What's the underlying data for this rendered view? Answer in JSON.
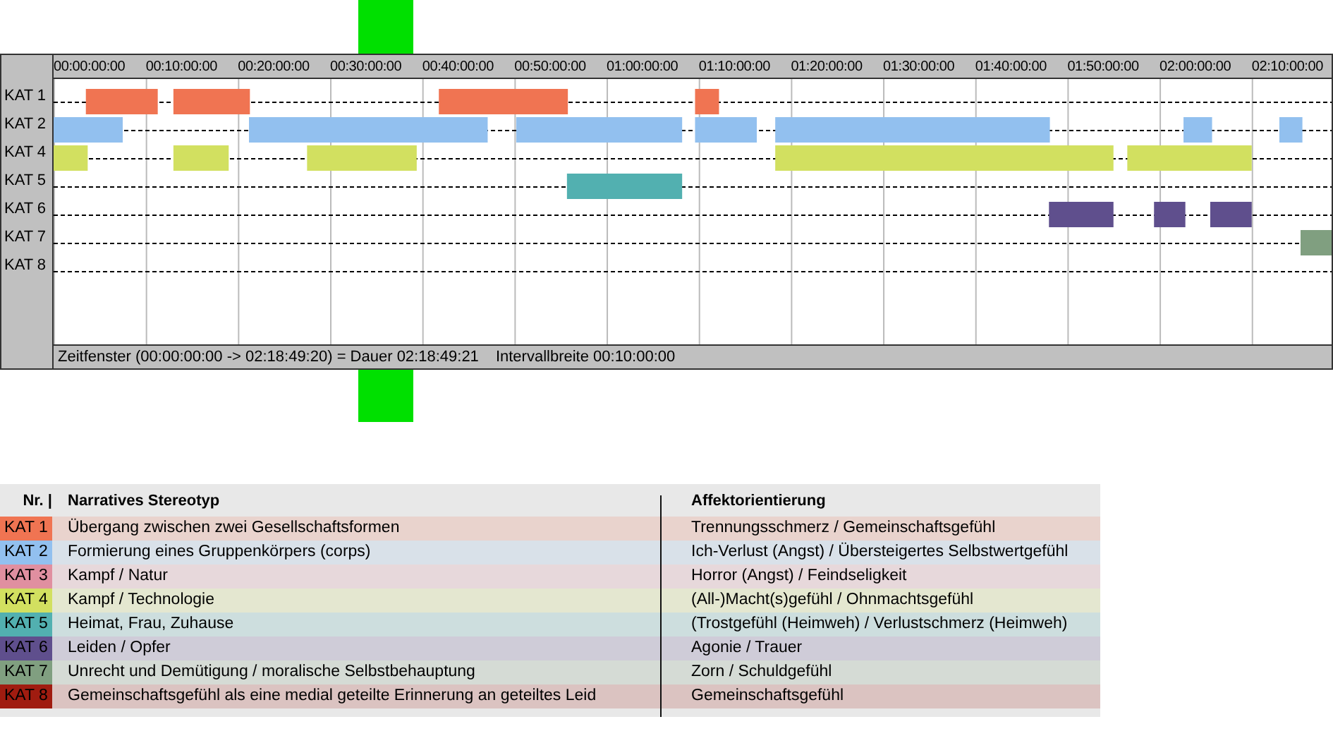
{
  "timeline": {
    "ruler_ticks": [
      "00:00:00:00",
      "00:10:00:00",
      "00:20:00:00",
      "00:30:00:00",
      "00:40:00:00",
      "00:50:00:00",
      "01:00:00:00",
      "01:10:00:00",
      "01:20:00:00",
      "01:30:00:00",
      "01:40:00:00",
      "01:50:00:00",
      "02:00:00:00",
      "02:10:00:00"
    ],
    "rows": [
      {
        "label": "KAT 1",
        "color": "#f07452"
      },
      {
        "label": "KAT 2",
        "color": "#92c0ef"
      },
      {
        "label": "KAT 4",
        "color": "#d2e060"
      },
      {
        "label": "KAT 5",
        "color": "#52b0b0"
      },
      {
        "label": "KAT 6",
        "color": "#5f4f8d"
      },
      {
        "label": "KAT 7",
        "color": "#809f80"
      },
      {
        "label": "KAT 8"
      }
    ],
    "status": {
      "window": "Zeitfenster (00:00:00:00 -> 02:18:49:20) = Dauer 02:18:49:21",
      "interval": "Intervallbreite 00:10:00:00"
    }
  },
  "legend": {
    "headers": [
      "Nr. |",
      "Narratives Stereotyp",
      "Affektorientierung"
    ],
    "rows": [
      {
        "nr": "KAT 1",
        "color": "#f07452",
        "stereotype": "Übergang zwischen zwei Gesellschaftsformen",
        "affect": "Trennungsschmerz / Gemeinschaftsgefühl"
      },
      {
        "nr": "KAT 2",
        "color": "#92c0ef",
        "stereotype": "Formierung eines Gruppenkörpers (corps)",
        "affect": "Ich-Verlust (Angst) / Übersteigertes Selbstwertgefühl"
      },
      {
        "nr": "KAT 3",
        "color": "#e08fa0",
        "stereotype": "Kampf / Natur",
        "affect": "Horror (Angst) / Feindseligkeit"
      },
      {
        "nr": "KAT 4",
        "color": "#d2e060",
        "stereotype": "Kampf / Technologie",
        "affect": "(All-)Macht(s)gefühl / Ohnmachtsgefühl"
      },
      {
        "nr": "KAT 5",
        "color": "#52b0b0",
        "stereotype": "Heimat, Frau, Zuhause",
        "affect": "(Trostgefühl (Heimweh) / Verlustschmerz (Heimweh)"
      },
      {
        "nr": "KAT 6",
        "color": "#5f4f8d",
        "stereotype": "Leiden / Opfer",
        "affect": "Agonie / Trauer"
      },
      {
        "nr": "KAT 7",
        "color": "#809f80",
        "stereotype": "Unrecht und Demütigung / moralische Selbstbehauptung",
        "affect": "Zorn / Schuldgefühl"
      },
      {
        "nr": "KAT 8",
        "color": "#a01c10",
        "stereotype": "Gemeinschaftsgefühl als eine medial geteilte Erinnerung an geteiltes Leid",
        "affect": "Gemeinschaftsgefühl"
      }
    ]
  }
}
